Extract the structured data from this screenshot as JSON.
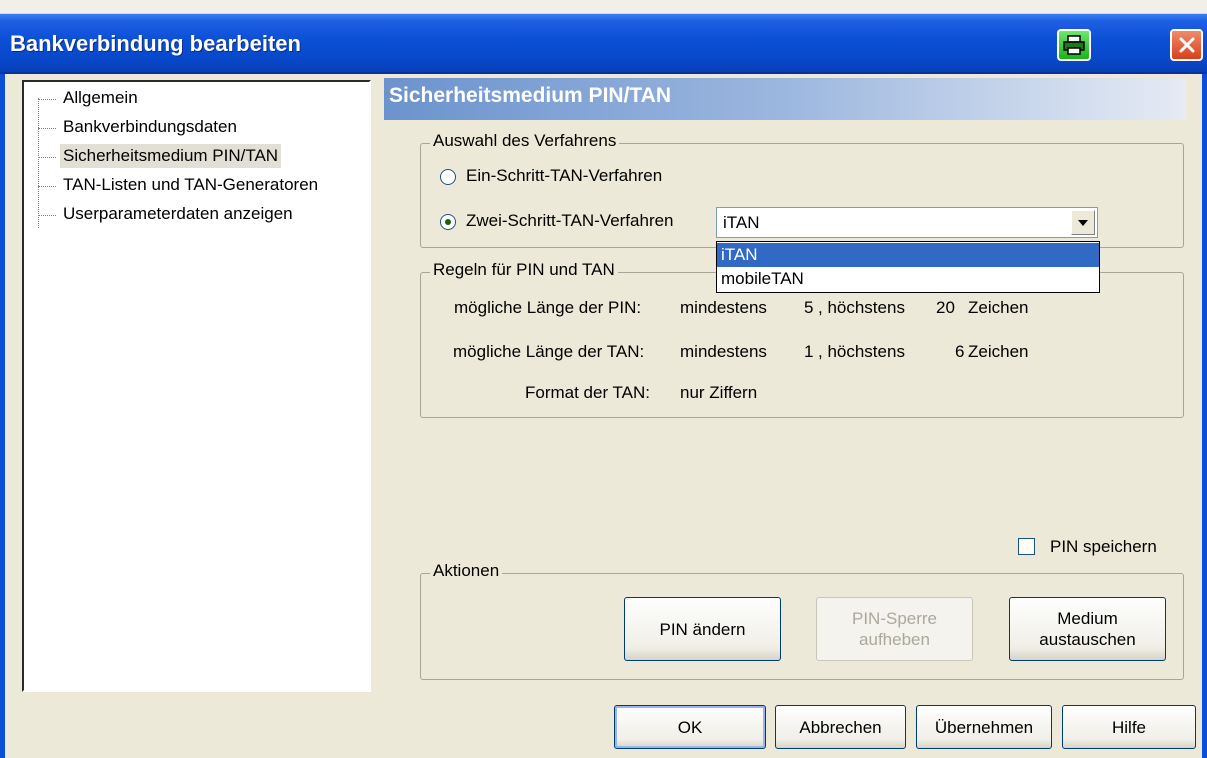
{
  "window": {
    "title": "Bankverbindung bearbeiten"
  },
  "titlebar_icons": {
    "print": "printer-icon",
    "close": "close-icon"
  },
  "tree": {
    "items": [
      {
        "label": "Allgemein"
      },
      {
        "label": "Bankverbindungsdaten"
      },
      {
        "label": "Sicherheitsmedium PIN/TAN",
        "selected": true
      },
      {
        "label": "TAN-Listen und TAN-Generatoren"
      },
      {
        "label": "Userparameterdaten anzeigen"
      }
    ]
  },
  "section": {
    "title": "Sicherheitsmedium PIN/TAN"
  },
  "verfahren": {
    "legend": "Auswahl des Verfahrens",
    "option1": "Ein-Schritt-TAN-Verfahren",
    "option2": "Zwei-Schritt-TAN-Verfahren",
    "selected_option": "option2",
    "combo_value": "iTAN",
    "combo_options": [
      "iTAN",
      "mobileTAN"
    ],
    "highlighted_option": "iTAN"
  },
  "regeln": {
    "legend": "Regeln für PIN und TAN",
    "pin_label": "mögliche Länge der PIN:",
    "pin_min_label": "mindestens",
    "pin_min": "5",
    "pin_max_label": ", höchstens",
    "pin_max": "20",
    "pin_unit": "Zeichen",
    "tan_label": "mögliche Länge der TAN:",
    "tan_min_label": "mindestens",
    "tan_min": "1",
    "tan_max_label": ", höchstens",
    "tan_max": "6",
    "tan_unit": "Zeichen",
    "format_label": "Format der TAN:",
    "format_value": "nur Ziffern"
  },
  "pin_speichern": {
    "label": "PIN speichern",
    "checked": false
  },
  "aktionen": {
    "legend": "Aktionen",
    "pin_aendern": "PIN ändern",
    "pin_sperre_line1": "PIN-Sperre",
    "pin_sperre_line2": "aufheben",
    "medium_line1": "Medium",
    "medium_line2": "austauschen"
  },
  "footer": {
    "ok": "OK",
    "abbrechen": "Abbrechen",
    "uebernehmen": "Übernehmen",
    "hilfe": "Hilfe"
  }
}
